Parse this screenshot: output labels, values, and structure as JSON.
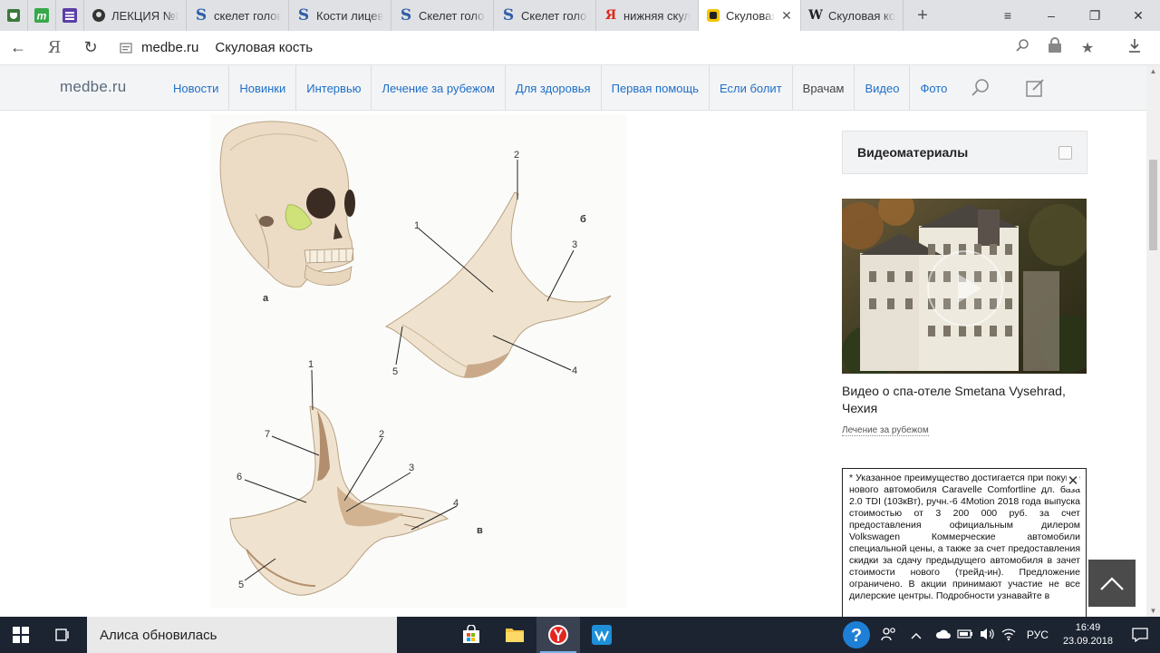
{
  "browser": {
    "tabs": [
      {
        "title": "ЛЕКЦИЯ №8",
        "icon": "lecture-favicon-icon",
        "active": false
      },
      {
        "title": "скелет голов",
        "icon": "s-favicon-icon",
        "active": false
      },
      {
        "title": "Кости лицев",
        "icon": "s-favicon-icon",
        "active": false
      },
      {
        "title": "Скелет голо",
        "icon": "s-favicon-icon",
        "active": false
      },
      {
        "title": "Скелет голо",
        "icon": "s-favicon-icon",
        "active": false
      },
      {
        "title": "нижняя скул",
        "icon": "yandex-favicon-icon",
        "active": false
      },
      {
        "title": "Скуловая",
        "icon": "medbe-favicon-icon",
        "active": true
      },
      {
        "title": "Скуловая ко",
        "icon": "wikipedia-favicon-icon",
        "active": false
      }
    ],
    "address": {
      "host": "medbe.ru",
      "page_title": "Скуловая кость"
    },
    "yandex_letter": "Я",
    "wiki_letter": "W",
    "s_letter": "S"
  },
  "site": {
    "logo": "medbe.ru",
    "nav": [
      "Новости",
      "Новинки",
      "Интервью",
      "Лечение за рубежом",
      "Для здоровья",
      "Первая помощь",
      "Если болит",
      "Врачам",
      "Видео",
      "Фото"
    ]
  },
  "figure": {
    "labels": {
      "a": "а",
      "b": "б",
      "v": "в",
      "n1": "1",
      "n2": "2",
      "n3": "3",
      "n4": "4",
      "n5": "5",
      "n6": "6",
      "n7": "7"
    }
  },
  "sidebar": {
    "widget_title": "Видеоматериалы",
    "video_title": "Видео о спа-отеле Smetana Vysehrad, Чехия",
    "video_category": "Лечение за рубежом",
    "ad_text": "* Указанное преимущество достигается при покупке нового автомобиля Caravelle Comfortline дл. база 2.0 TDI (103кВт), ручн.-6 4Motion 2018 года выпуска стоимостью от 3 200 000 руб. за счет предоставления официальным дилером Volkswagen Коммерческие автомобили специальной цены, а также за счет предоставления скидки за сдачу предыдущего автомобиля в зачет стоимости нового (трейд-ин). Предложение ограничено. В акции принимают участие не все дилерские центры. Подробности узнавайте в"
  },
  "taskbar": {
    "search_text": "Алиса обновилась",
    "language": "РУС",
    "time": "16:49",
    "date": "23.09.2018"
  },
  "colors": {
    "nav_link": "#1e6fc7",
    "taskbar": "#1c2432",
    "tab_strip": "#dfe1e5"
  }
}
